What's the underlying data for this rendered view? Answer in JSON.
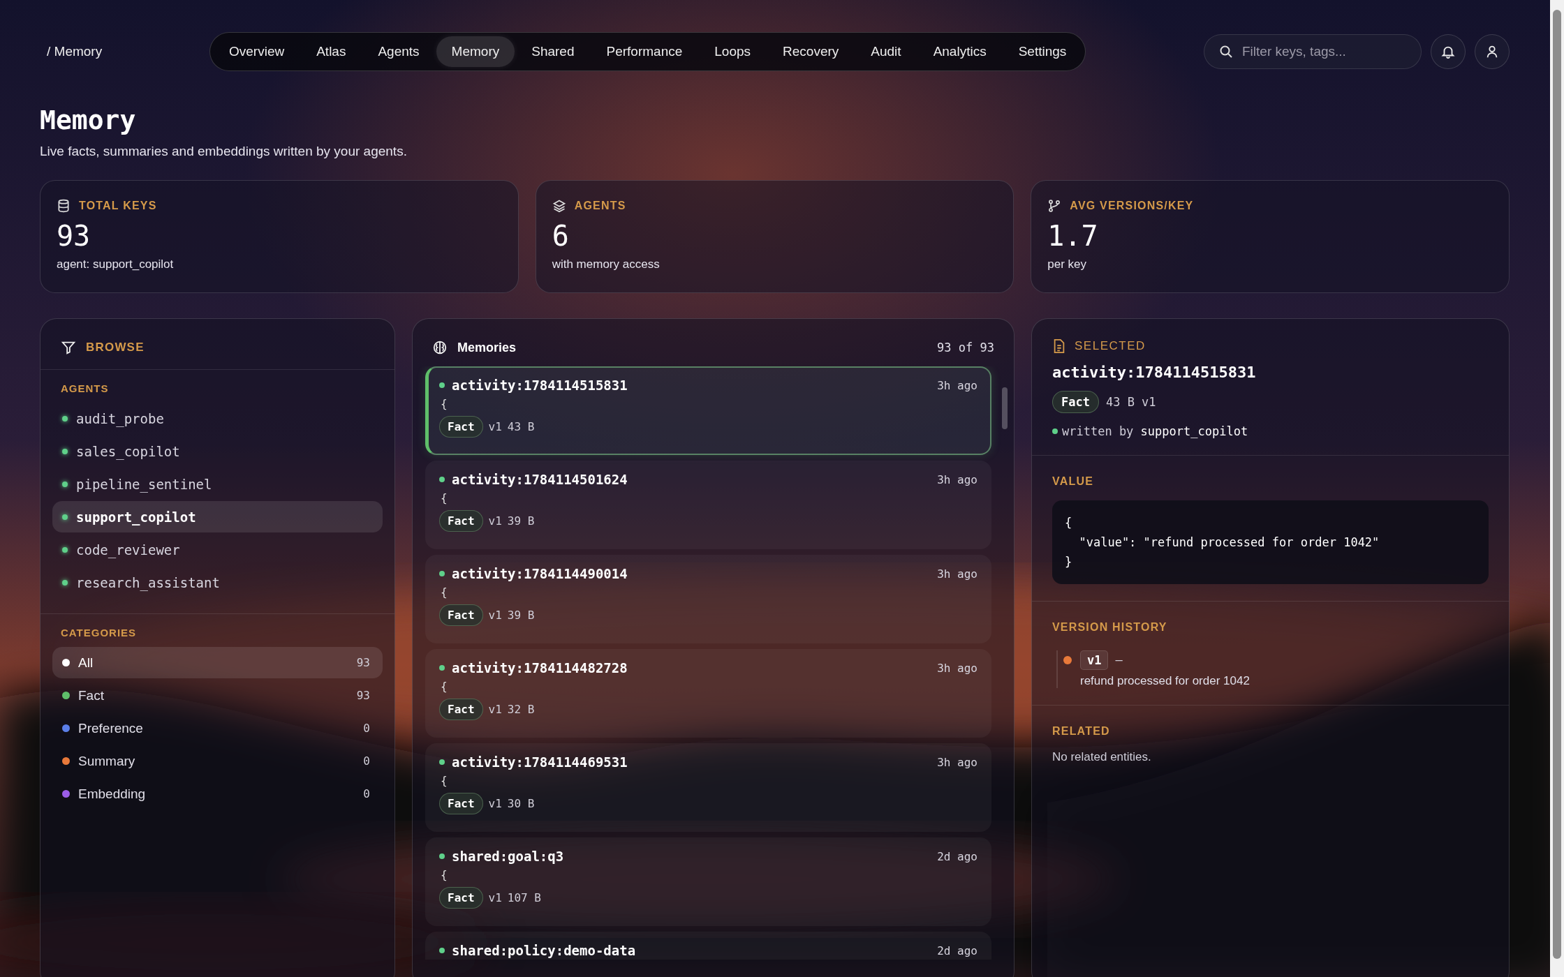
{
  "breadcrumb": "/ Memory",
  "nav": [
    {
      "label": "Overview",
      "selected": false
    },
    {
      "label": "Atlas",
      "selected": false
    },
    {
      "label": "Agents",
      "selected": false
    },
    {
      "label": "Memory",
      "selected": true
    },
    {
      "label": "Shared",
      "selected": false
    },
    {
      "label": "Performance",
      "selected": false
    },
    {
      "label": "Loops",
      "selected": false
    },
    {
      "label": "Recovery",
      "selected": false
    },
    {
      "label": "Audit",
      "selected": false
    },
    {
      "label": "Analytics",
      "selected": false
    },
    {
      "label": "Settings",
      "selected": false
    }
  ],
  "search": {
    "placeholder": "Filter keys, tags..."
  },
  "page": {
    "title": "Memory",
    "subtitle": "Live facts, summaries and embeddings written by your agents."
  },
  "stats": [
    {
      "label": "TOTAL KEYS",
      "value": "93",
      "caption": "agent: support_copilot"
    },
    {
      "label": "AGENTS",
      "value": "6",
      "caption": "with memory access"
    },
    {
      "label": "AVG VERSIONS/KEY",
      "value": "1.7",
      "caption": "per key"
    }
  ],
  "browse": {
    "title": "BROWSE",
    "agents_heading": "AGENTS",
    "agents": [
      {
        "name": "audit_probe",
        "selected": false
      },
      {
        "name": "sales_copilot",
        "selected": false
      },
      {
        "name": "pipeline_sentinel",
        "selected": false
      },
      {
        "name": "support_copilot",
        "selected": true
      },
      {
        "name": "code_reviewer",
        "selected": false
      },
      {
        "name": "research_assistant",
        "selected": false
      }
    ],
    "categories_heading": "CATEGORIES",
    "categories": [
      {
        "name": "All",
        "count": "93",
        "color": "#ffffff",
        "selected": true
      },
      {
        "name": "Fact",
        "count": "93",
        "color": "#5fbf6a",
        "selected": false
      },
      {
        "name": "Preference",
        "count": "0",
        "color": "#5b7fe8",
        "selected": false
      },
      {
        "name": "Summary",
        "count": "0",
        "color": "#e8793a",
        "selected": false
      },
      {
        "name": "Embedding",
        "count": "0",
        "color": "#9b5de8",
        "selected": false
      }
    ]
  },
  "memories": {
    "title": "Memories",
    "count": "93 of 93",
    "items": [
      {
        "key": "activity:1784114515831",
        "time": "3h ago",
        "preview": "{",
        "tag": "Fact",
        "version": "v1",
        "size": "43 B",
        "selected": true
      },
      {
        "key": "activity:1784114501624",
        "time": "3h ago",
        "preview": "{",
        "tag": "Fact",
        "version": "v1",
        "size": "39 B",
        "selected": false
      },
      {
        "key": "activity:1784114490014",
        "time": "3h ago",
        "preview": "{",
        "tag": "Fact",
        "version": "v1",
        "size": "39 B",
        "selected": false
      },
      {
        "key": "activity:1784114482728",
        "time": "3h ago",
        "preview": "{",
        "tag": "Fact",
        "version": "v1",
        "size": "32 B",
        "selected": false
      },
      {
        "key": "activity:1784114469531",
        "time": "3h ago",
        "preview": "{",
        "tag": "Fact",
        "version": "v1",
        "size": "30 B",
        "selected": false
      },
      {
        "key": "shared:goal:q3",
        "time": "2d ago",
        "preview": "{",
        "tag": "Fact",
        "version": "v1",
        "size": "107 B",
        "selected": false
      },
      {
        "key": "shared:policy:demo-data",
        "time": "2d ago",
        "selected": false
      }
    ]
  },
  "detail": {
    "heading": "SELECTED",
    "key": "activity:1784114515831",
    "tag": "Fact",
    "size": "43 B",
    "version": "v1",
    "written_by": "written by **support_copilot**",
    "value_heading": "VALUE",
    "value": "{\n  \"value\": \"refund processed for order 1042\"\n}",
    "history_heading": "VERSION HISTORY",
    "history": [
      {
        "version": "v1",
        "dash": "–",
        "text": "refund processed for order 1042"
      }
    ],
    "related_heading": "RELATED",
    "related_empty": "No related entities."
  }
}
